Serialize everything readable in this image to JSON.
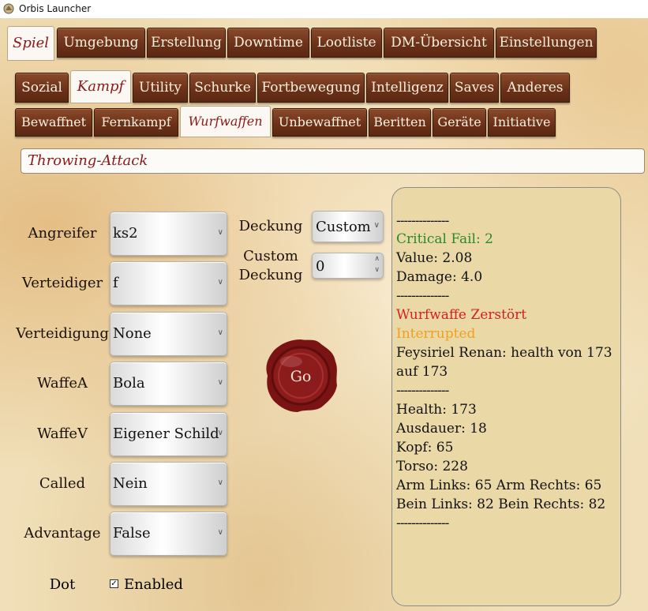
{
  "window": {
    "title": "Orbis Launcher"
  },
  "main_tabs": [
    {
      "label": "Spiel",
      "active": true
    },
    {
      "label": "Umgebung"
    },
    {
      "label": "Erstellung"
    },
    {
      "label": "Downtime"
    },
    {
      "label": "Lootliste"
    },
    {
      "label": "DM-Übersicht"
    },
    {
      "label": "Einstellungen"
    }
  ],
  "sub_tabs": [
    {
      "label": "Sozial"
    },
    {
      "label": "Kampf",
      "active": true
    },
    {
      "label": "Utility"
    },
    {
      "label": "Schurke"
    },
    {
      "label": "Fortbewegung"
    },
    {
      "label": "Intelligenz"
    },
    {
      "label": "Saves"
    },
    {
      "label": "Anderes"
    }
  ],
  "combat_tabs": [
    {
      "label": "Bewaffnet"
    },
    {
      "label": "Fernkampf"
    },
    {
      "label": "Wurfwaffen",
      "active": true
    },
    {
      "label": "Unbewaffnet"
    },
    {
      "label": "Beritten"
    },
    {
      "label": "Geräte"
    },
    {
      "label": "Initiative"
    }
  ],
  "title_field": "Throwing-Attack",
  "form": {
    "rows": [
      {
        "label": "Angreifer",
        "value": "ks2"
      },
      {
        "label": "Verteidiger",
        "value": "f"
      },
      {
        "label": "Verteidigung",
        "value": "None"
      },
      {
        "label": "WaffeA",
        "value": "Bola"
      },
      {
        "label": "WaffeV",
        "value": "Eigener Schild"
      },
      {
        "label": "Called",
        "value": "Nein"
      },
      {
        "label": "Advantage",
        "value": "False"
      }
    ],
    "deckung_label": "Deckung",
    "deckung_value": "Custom",
    "custom_deckung_label_1": "Custom",
    "custom_deckung_label_2": "Deckung",
    "custom_deckung_value": "0",
    "dot_label": "Dot",
    "dot_checkbox_label": "Enabled",
    "dot_checked": true,
    "go_label": "Go"
  },
  "results": {
    "separator": "--------------",
    "critical_fail": "Critical Fail: 2",
    "value": "Value: 2.08",
    "damage": "Damage: 4.0",
    "destroyed": "Wurfwaffe Zerstört",
    "interrupted": "Interrupted",
    "health_change_1": "Feysiriel Renan: health von 173",
    "health_change_2": "auf 173",
    "health": "Health: 173",
    "ausdauer": "Ausdauer: 18",
    "kopf": "Kopf: 65",
    "torso": "Torso: 228",
    "arms": "Arm Links: 65 Arm Rechts: 65",
    "legs": "Bein Links: 82 Bein Rechts: 82",
    "colors": {
      "critical": "#2a8a2a",
      "destroyed": "#d42020",
      "interrupted": "#f0a020"
    }
  },
  "colors": {
    "tab_brown": "#6b3018",
    "active_tab_text": "#8b1a1a",
    "panel_bg": "#ead9a6",
    "seal": "#8c1c1c"
  }
}
